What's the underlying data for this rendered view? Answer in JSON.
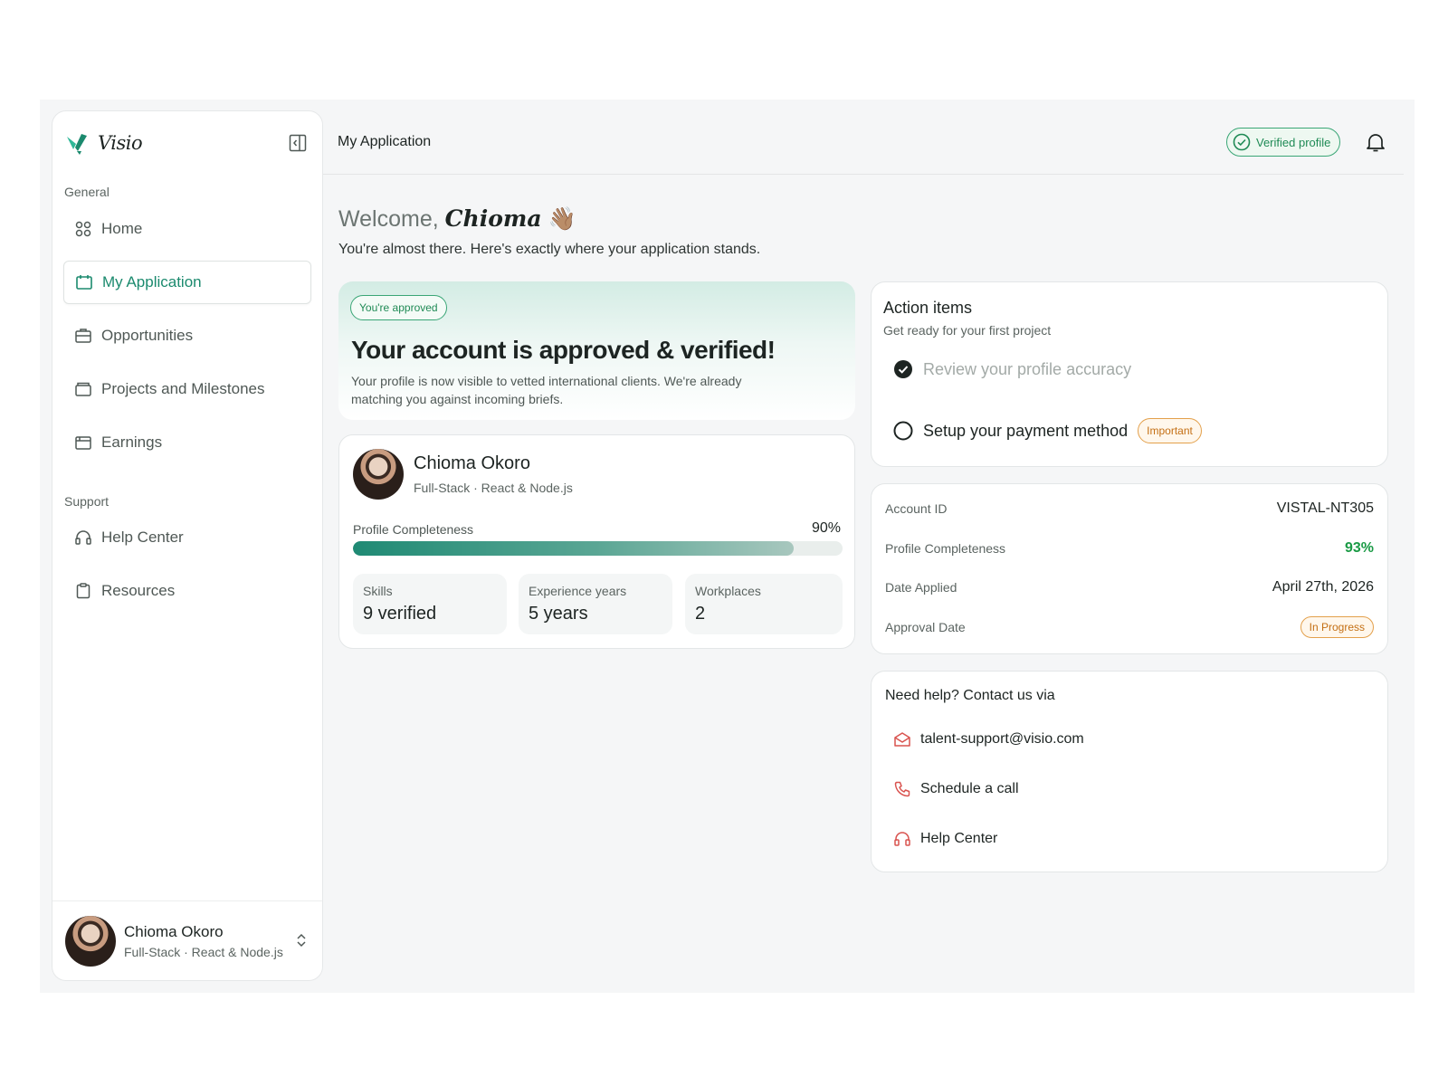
{
  "app": {
    "name": "Visio"
  },
  "sidebar": {
    "sections": {
      "general": "General",
      "support": "Support"
    },
    "general_items": [
      {
        "label": "Home",
        "icon": "grid-icon"
      },
      {
        "label": "My Application",
        "icon": "application-icon",
        "active": true
      },
      {
        "label": "Opportunities",
        "icon": "briefcase-icon"
      },
      {
        "label": "Projects and Milestones",
        "icon": "folder-icon"
      },
      {
        "label": "Earnings",
        "icon": "wallet-icon"
      }
    ],
    "support_items": [
      {
        "label": "Help Center",
        "icon": "headset-icon"
      },
      {
        "label": "Resources",
        "icon": "clipboard-icon"
      }
    ],
    "user": {
      "name": "Chioma Okoro",
      "role": "Full-Stack · React & Node.js"
    }
  },
  "header": {
    "title": "My Application",
    "verified_label": "Verified profile"
  },
  "welcome": {
    "prefix": "Welcome,",
    "name": "Chioma",
    "emoji": "👋🏽",
    "subtitle": "You're almost there. Here's exactly where your application stands."
  },
  "approved": {
    "tag": "You're approved",
    "heading": "Your account is approved & verified!",
    "body": "Your profile is now visible to vetted international clients. We're already matching you against incoming briefs."
  },
  "profile": {
    "name": "Chioma Okoro",
    "role": "Full-Stack · React & Node.js",
    "completeness_label": "Profile Completeness",
    "completeness_value": "90%",
    "completeness_fraction": 0.9,
    "stats": [
      {
        "label": "Skills",
        "value": "9 verified"
      },
      {
        "label": "Experience years",
        "value": "5 years"
      },
      {
        "label": "Workplaces",
        "value": "2"
      }
    ]
  },
  "action_items": {
    "title": "Action items",
    "subtitle": "Get ready for your first project",
    "items": [
      {
        "label": "Review your profile accuracy",
        "done": true
      },
      {
        "label": "Setup your payment method",
        "done": false,
        "tag": "Important"
      }
    ]
  },
  "account": {
    "rows": [
      {
        "label": "Account ID",
        "value": "VISTAL-NT305"
      },
      {
        "label": "Profile Completeness",
        "value": "93%"
      },
      {
        "label": "Date Applied",
        "value": "April 27th, 2026"
      },
      {
        "label": "Approval Date",
        "value": "In Progress"
      }
    ]
  },
  "help": {
    "title": "Need help? Contact us via",
    "items": [
      {
        "label": "talent-support@visio.com",
        "icon": "mail-icon"
      },
      {
        "label": "Schedule a call",
        "icon": "phone-icon"
      },
      {
        "label": "Help Center",
        "icon": "headset-icon"
      }
    ]
  },
  "colors": {
    "accent": "#1b8a6e",
    "success": "#1a9a45",
    "warning": "#c46f14",
    "help_icon": "#d9534f"
  }
}
